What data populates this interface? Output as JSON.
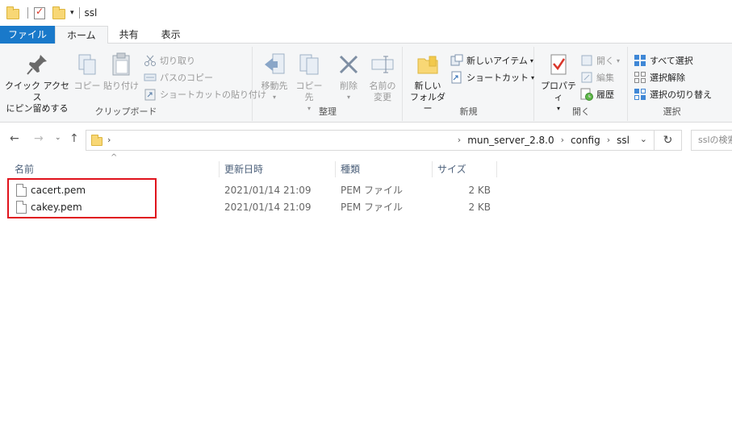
{
  "window": {
    "title": "ssl"
  },
  "tabs": [
    {
      "label": "ファイル"
    },
    {
      "label": "ホーム"
    },
    {
      "label": "共有"
    },
    {
      "label": "表示"
    }
  ],
  "ribbon": {
    "clipboard": {
      "label": "クリップボード",
      "pin_line1": "クイック アクセス",
      "pin_line2": "にピン留めする",
      "copy": "コピー",
      "paste": "貼り付け",
      "cut": "切り取り",
      "copy_path": "パスのコピー",
      "paste_shortcut": "ショートカットの貼り付け"
    },
    "organize": {
      "label": "整理",
      "move_to": "移動先",
      "copy_to": "コピー先",
      "delete": "削除",
      "rename_line1": "名前の",
      "rename_line2": "変更"
    },
    "new": {
      "label": "新規",
      "new_folder_line1": "新しい",
      "new_folder_line2": "フォルダー",
      "new_item": "新しいアイテム",
      "easy_access": "ショートカット"
    },
    "open": {
      "label": "開く",
      "properties": "プロパティ",
      "open": "開く",
      "edit": "編集",
      "history": "履歴"
    },
    "select": {
      "label": "選択",
      "select_all": "すべて選択",
      "select_none": "選択解除",
      "invert": "選択の切り替え"
    }
  },
  "address": {
    "crumbs": [
      "mun_server_2.8.0",
      "config",
      "ssl"
    ],
    "search_placeholder": "sslの検索"
  },
  "columns": {
    "name": "名前",
    "date": "更新日時",
    "type": "種類",
    "size": "サイズ"
  },
  "files": [
    {
      "name": "cacert.pem",
      "date": "2021/01/14 21:09",
      "type": "PEM ファイル",
      "size": "2 KB"
    },
    {
      "name": "cakey.pem",
      "date": "2021/01/14 21:09",
      "type": "PEM ファイル",
      "size": "2 KB"
    }
  ],
  "colors": {
    "file_tab": "#1979ca",
    "highlight_border": "#e0121c",
    "folder": "#f8d775"
  }
}
